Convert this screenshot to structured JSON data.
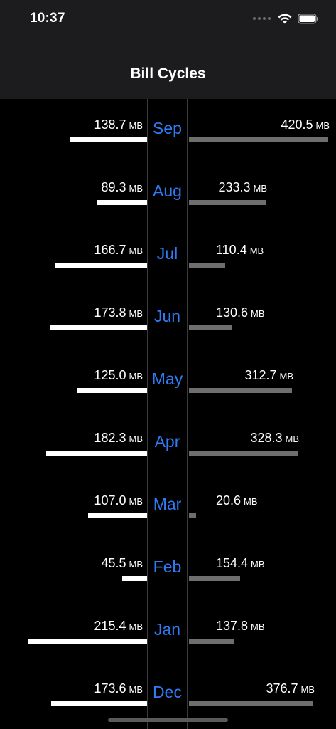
{
  "status_bar": {
    "time": "10:37"
  },
  "nav": {
    "title": "Bill Cycles"
  },
  "unit": "MB",
  "cycles": [
    {
      "month": "Sep",
      "left": "138.7",
      "right": "420.5"
    },
    {
      "month": "Aug",
      "left": "89.3",
      "right": "233.3"
    },
    {
      "month": "Jul",
      "left": "166.7",
      "right": "110.4"
    },
    {
      "month": "Jun",
      "left": "173.8",
      "right": "130.6"
    },
    {
      "month": "May",
      "left": "125.0",
      "right": "312.7"
    },
    {
      "month": "Apr",
      "left": "182.3",
      "right": "328.3"
    },
    {
      "month": "Mar",
      "left": "107.0",
      "right": "20.6"
    },
    {
      "month": "Feb",
      "left": "45.5",
      "right": "154.4"
    },
    {
      "month": "Jan",
      "left": "215.4",
      "right": "137.8"
    },
    {
      "month": "Dec",
      "left": "173.6",
      "right": "376.7"
    }
  ],
  "colors": {
    "month_label": "#2f7bf5",
    "left_bar": "#ffffff",
    "right_bar": "#6e6e6e",
    "background": "#000000",
    "header": "#1c1c1e"
  },
  "icons": [
    "signal-icon",
    "wifi-icon",
    "battery-icon"
  ]
}
